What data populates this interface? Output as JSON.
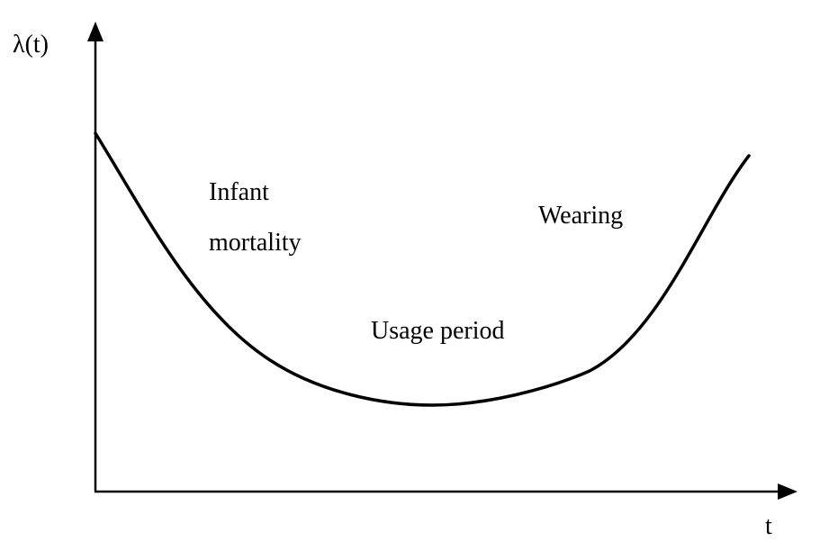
{
  "diagram": {
    "y_axis_label": "λ(t)",
    "x_axis_label": "t",
    "regions": {
      "infant_line1": "Infant",
      "infant_line2": "mortality",
      "usage": "Usage period",
      "wearing": "Wearing"
    },
    "colors": {
      "stroke": "#000000",
      "background": "#ffffff"
    }
  }
}
